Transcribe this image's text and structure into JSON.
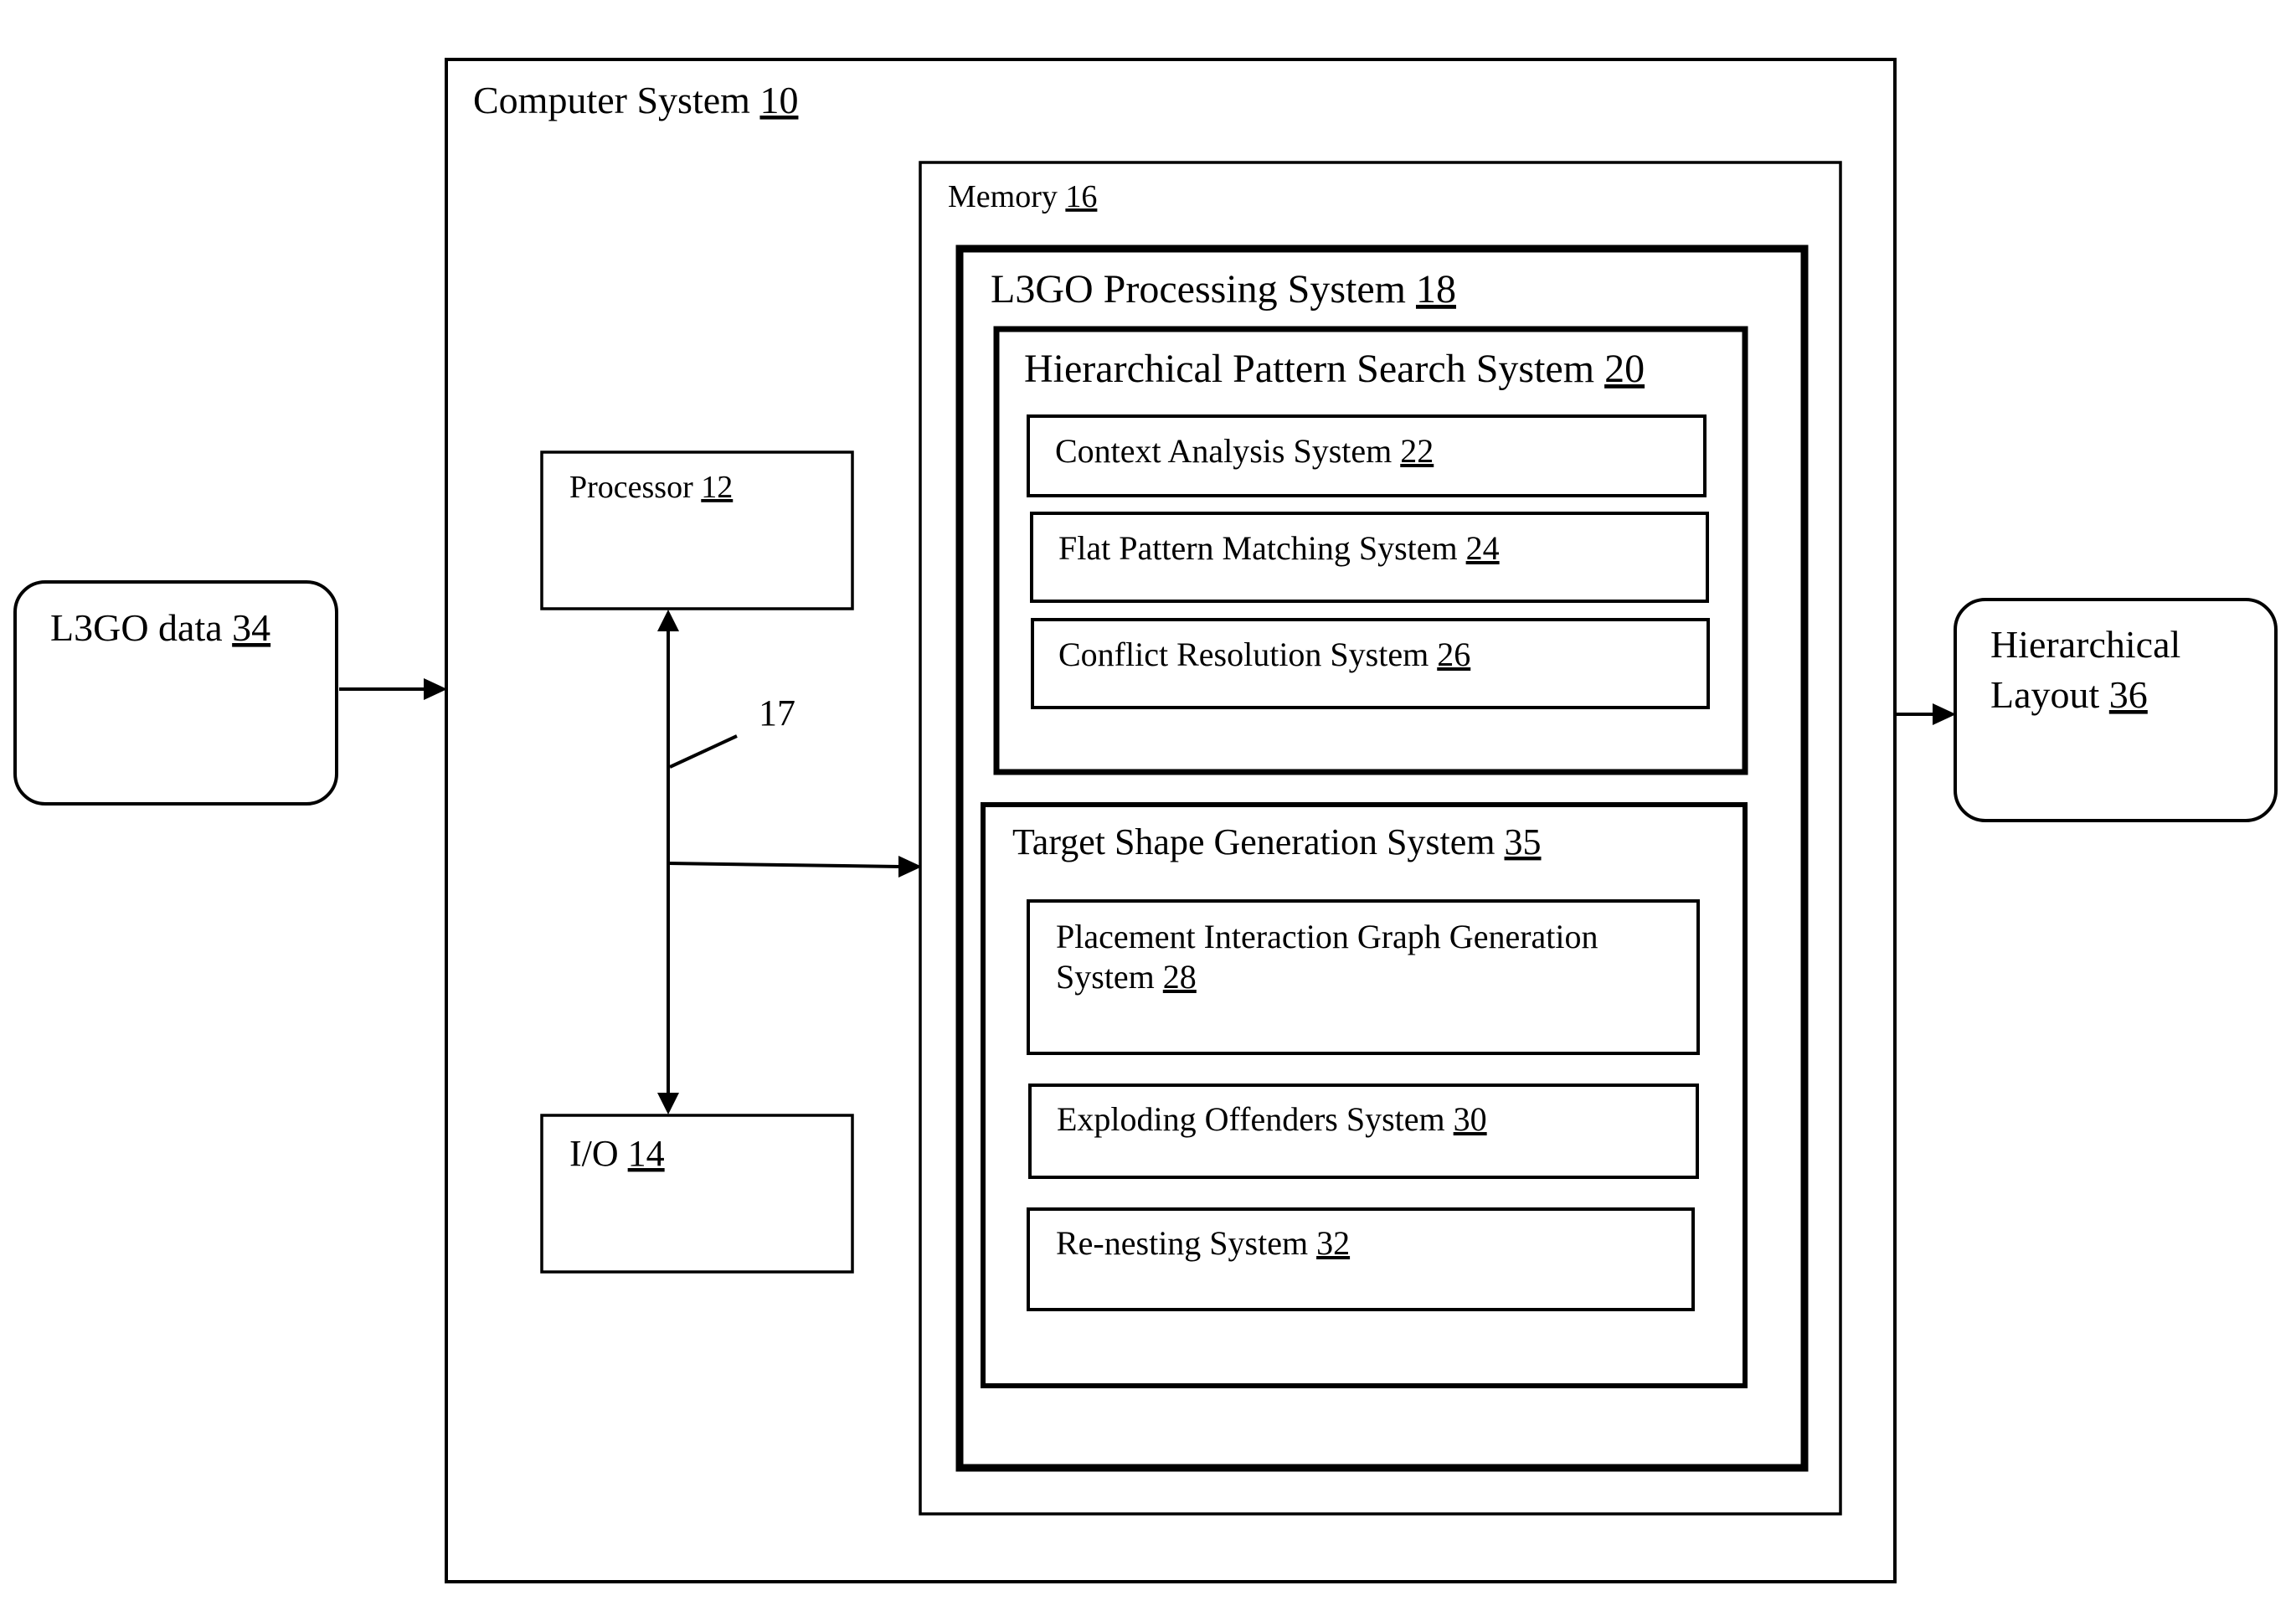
{
  "diagram": {
    "nodes": {
      "computer_system": {
        "label": "Computer System",
        "ref": "10"
      },
      "processor": {
        "label": "Processor",
        "ref": "12"
      },
      "io": {
        "label": "I/O",
        "ref": "14"
      },
      "bus": {
        "ref": "17"
      },
      "memory": {
        "label": "Memory",
        "ref": "16"
      },
      "l3go_processing": {
        "label": "L3GO Processing System",
        "ref": "18"
      },
      "hier_pattern_search": {
        "label": "Hierarchical Pattern Search System",
        "ref": "20"
      },
      "context_analysis": {
        "label": "Context Analysis System",
        "ref": "22"
      },
      "flat_pattern_matching": {
        "label": "Flat Pattern Matching System",
        "ref": "24"
      },
      "conflict_resolution": {
        "label": "Conflict Resolution System",
        "ref": "26"
      },
      "target_shape_generation": {
        "label": "Target Shape Generation System",
        "ref": "35"
      },
      "placement_interaction_line1": {
        "label": "Placement Interaction Graph Generation"
      },
      "placement_interaction_line2": {
        "label": "System",
        "ref": "28"
      },
      "exploding_offenders": {
        "label": "Exploding Offenders System",
        "ref": "30"
      },
      "re_nesting": {
        "label": "Re-nesting System",
        "ref": "32"
      },
      "l3go_data": {
        "label": "L3GO data",
        "ref": "34"
      },
      "hier_layout_line1": {
        "label": "Hierarchical"
      },
      "hier_layout_line2": {
        "label": "Layout",
        "ref": "36"
      }
    },
    "edges": [
      {
        "from": "L3GO data 34",
        "to": "Computer System 10"
      },
      {
        "from": "Computer System 10",
        "to": "Hierarchical Layout 36"
      },
      {
        "from": "Bus 17",
        "to": "Processor 12"
      },
      {
        "from": "Bus 17",
        "to": "I/O 14"
      },
      {
        "from": "Bus 17",
        "to": "Memory 16"
      }
    ]
  }
}
